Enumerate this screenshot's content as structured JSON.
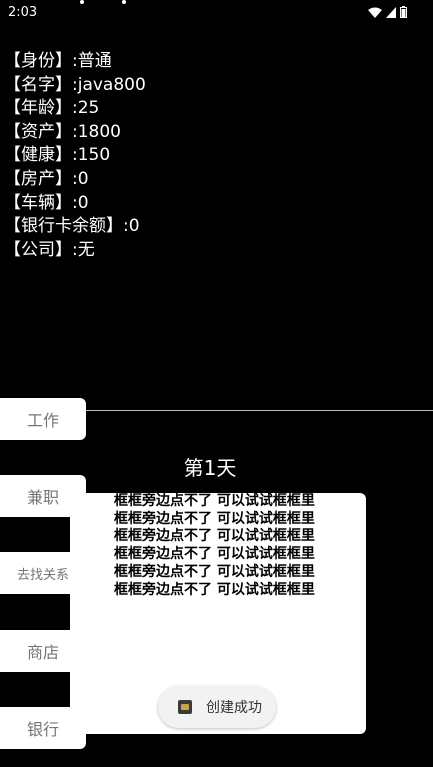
{
  "status_bar": {
    "time": "2:03",
    "icons": [
      "wifi-icon",
      "signal-icon",
      "battery-icon"
    ]
  },
  "player": {
    "rows": [
      "【身份】:普通",
      "【名字】:java800",
      "【年龄】:25",
      "【资产】:1800",
      "【健康】:150",
      "【房产】:0",
      "【车辆】:0",
      "【银行卡余额】:0",
      "【公司】:无"
    ]
  },
  "actions": {
    "work": "工作",
    "part_time": "兼职",
    "connections": "去找关系",
    "shop": "商店",
    "bank": "银行"
  },
  "day_label": "第1天",
  "event_log": [
    "框框旁边点不了 可以试试框框里",
    "框框旁边点不了 可以试试框框里",
    "框框旁边点不了 可以试试框框里",
    "框框旁边点不了 可以试试框框里",
    "框框旁边点不了 可以试试框框里",
    "框框旁边点不了 可以试试框框里"
  ],
  "toast": {
    "text": "创建成功"
  }
}
